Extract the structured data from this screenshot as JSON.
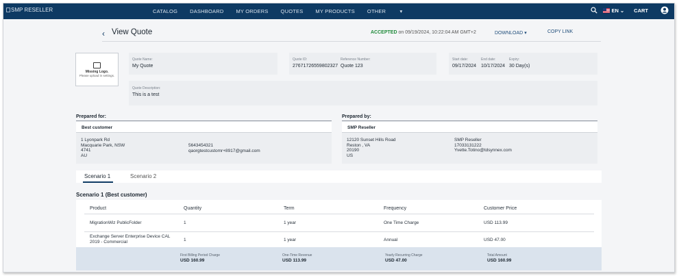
{
  "nav": {
    "brand": "SMP RESELLER",
    "links": [
      "CATALOG",
      "DASHBOARD",
      "MY ORDERS",
      "QUOTES",
      "MY PRODUCTS",
      "OTHER"
    ],
    "language": "EN",
    "cart": "CART"
  },
  "header": {
    "title": "View Quote",
    "status": "ACCEPTED",
    "status_detail": "on 09/19/2024, 10:22:04 AM GMT+2",
    "download": "DOWNLOAD",
    "copy_link": "COPY LINK",
    "status_color": "#1f8a3a"
  },
  "logo": {
    "title": "Missing Logo.",
    "subtitle": "Please upload in settings."
  },
  "quote": {
    "name_label": "Quote Name:",
    "name": "My Quote",
    "id_label": "Quote ID:",
    "id": "27671726559802327",
    "ref_label": "Reference Number:",
    "ref": "Quote 123",
    "start_label": "Start date:",
    "start": "09/17/2024",
    "end_label": "End date:",
    "end": "10/17/2024",
    "expiry_label": "Expiry:",
    "expiry": "30 Day(s)",
    "desc_label": "Quote Description:",
    "desc": "This is a test"
  },
  "prepared_for": {
    "heading": "Prepared for:",
    "name": "Best customer",
    "address": [
      "1 Lyonpark Rd",
      "Macquarie Park, NSW",
      "4741",
      "AU"
    ],
    "phone": "5643454321",
    "email": "qaorgtestcustomr+8917@gmail.com"
  },
  "prepared_by": {
    "heading": "Prepared by:",
    "name": "SMP Reseller",
    "address": [
      "12120 Sunset Hills Road",
      "Reston , VA",
      "20190",
      "US"
    ],
    "contact": [
      "SMP Reseller",
      "17033131222",
      "Yvette.Totino@tdsynnex.com"
    ]
  },
  "tabs": [
    "Scenario 1",
    "Scenario 2"
  ],
  "scenario": {
    "title": "Scenario 1 (Best customer)",
    "columns": [
      "Product",
      "Quantity",
      "Term",
      "Frequency",
      "Customer Price"
    ],
    "rows": [
      [
        "MigrationWiz PublicFolder",
        "1",
        "1 year",
        "One Time Charge",
        "USD 113.99"
      ],
      [
        "Exchange Server Enterprise Device CAL",
        "1",
        "1 year",
        "Annual",
        "USD 47.00"
      ]
    ],
    "row2_product_line2": "2019 - Commercial",
    "totals": [
      {
        "label": "First Billing Period Charge",
        "value": "USD 160.99"
      },
      {
        "label": "One-Time Revenue",
        "value": "USD 113.99"
      },
      {
        "label": "Yearly Recurring Charge",
        "value": "USD 47.00"
      },
      {
        "label": "Total Amount",
        "value": "USD 160.99"
      }
    ]
  }
}
